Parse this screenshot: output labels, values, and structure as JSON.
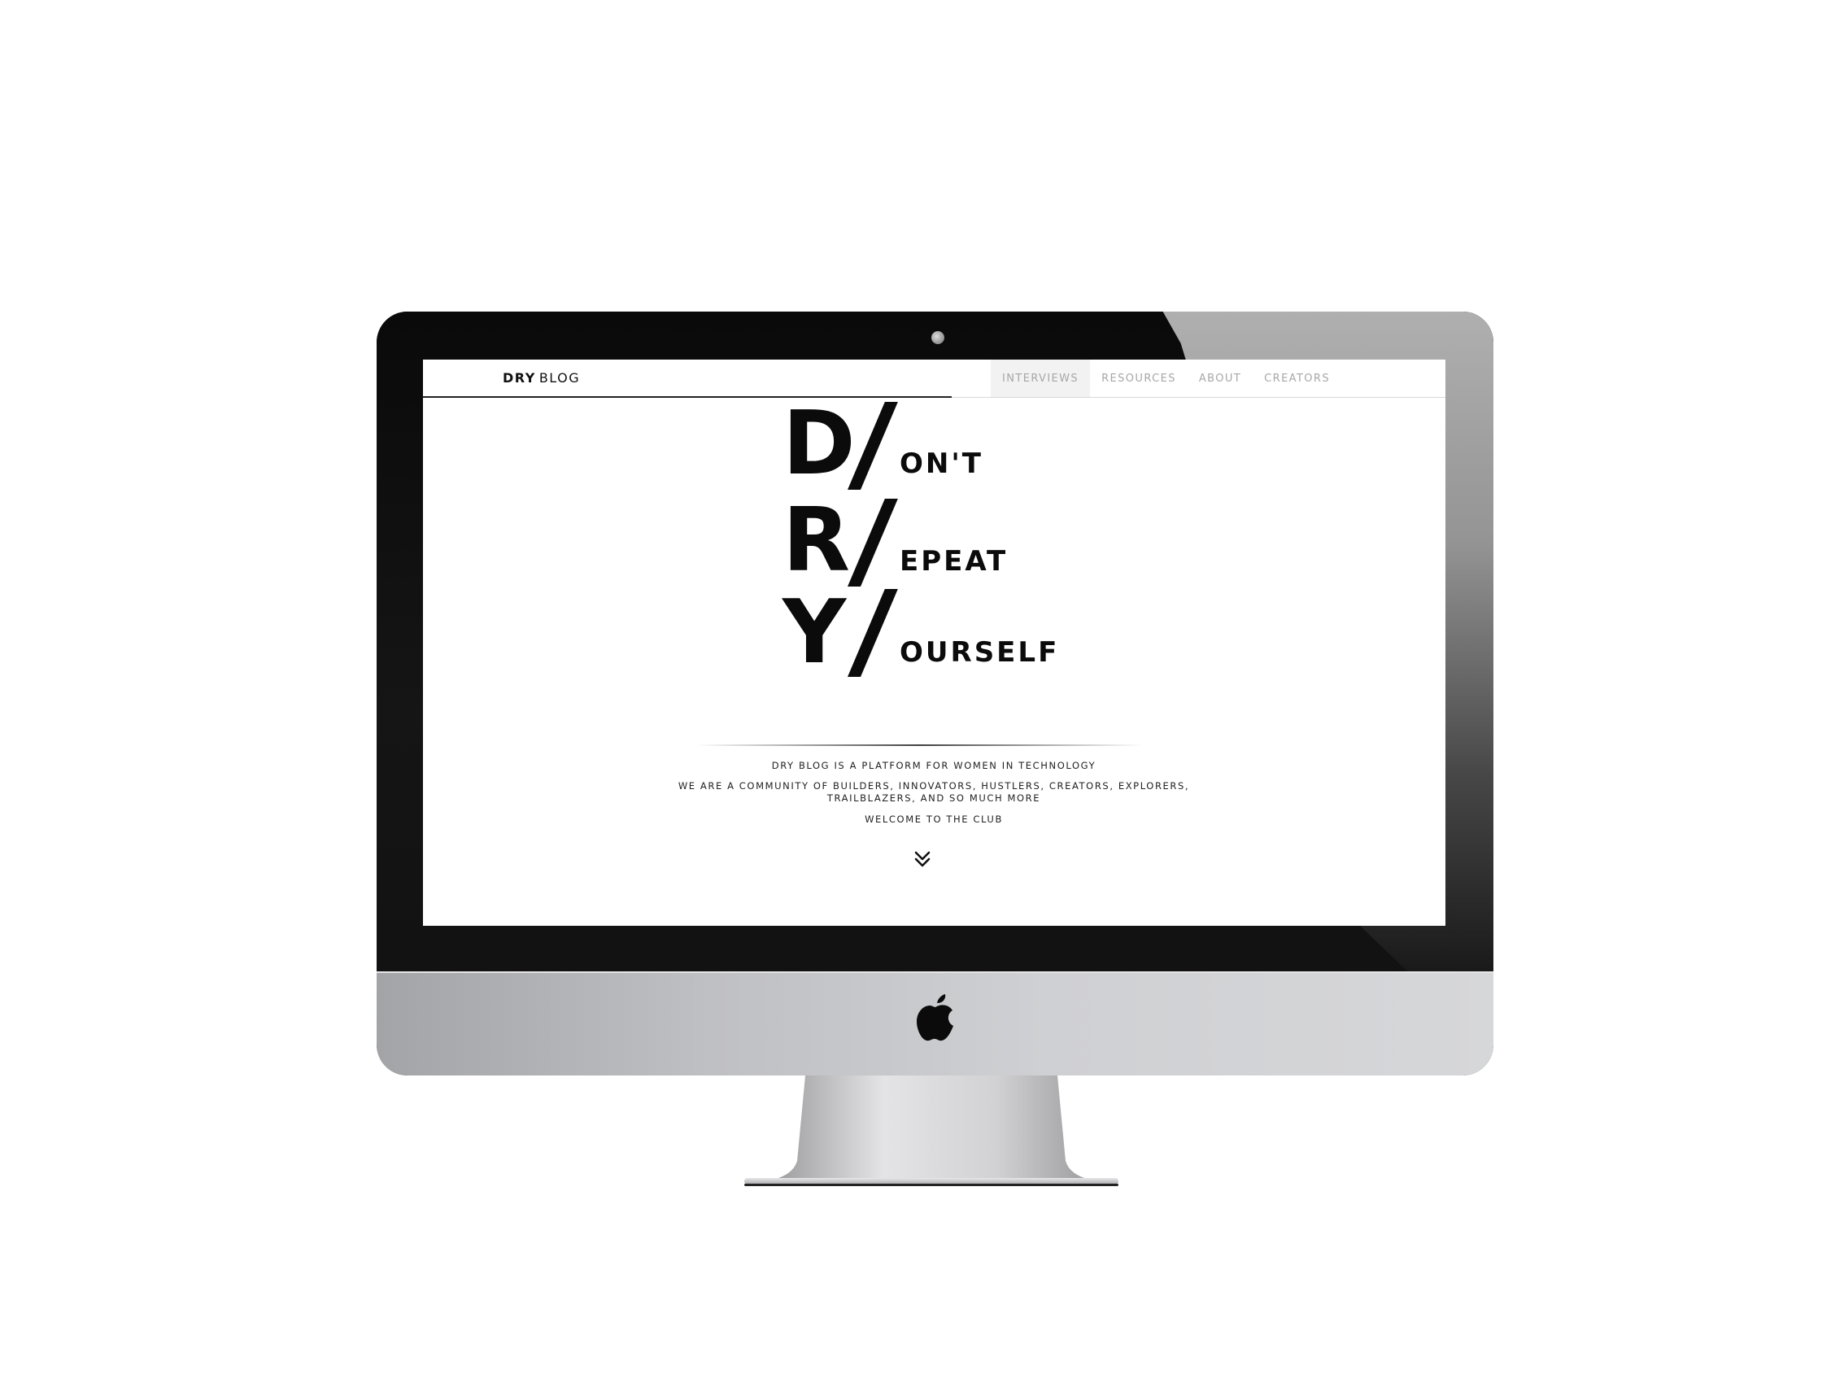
{
  "site": {
    "logo_bold": "DRY",
    "logo_light": "BLOG"
  },
  "nav": {
    "items": [
      {
        "label": "INTERVIEWS",
        "active": true
      },
      {
        "label": "RESOURCES"
      },
      {
        "label": "ABOUT"
      },
      {
        "label": "CREATORS"
      }
    ]
  },
  "hero": {
    "rows": [
      {
        "letter": "D",
        "word": "ON'T"
      },
      {
        "letter": "R",
        "word": "EPEAT"
      },
      {
        "letter": "Y",
        "word": "OURSELF"
      }
    ],
    "line1": "DRY BLOG IS A PLATFORM FOR WOMEN IN TECHNOLOGY",
    "line2a": "WE ARE A COMMUNITY OF BUILDERS, INNOVATORS, HUSTLERS, CREATORS, EXPLORERS,",
    "line2b": "TRAILBLAZERS, AND SO MUCH MORE",
    "line3": "WELCOME TO THE CLUB"
  },
  "icons": {
    "scroll": "double-chevron-down-icon",
    "brand": "apple-logo-icon"
  }
}
